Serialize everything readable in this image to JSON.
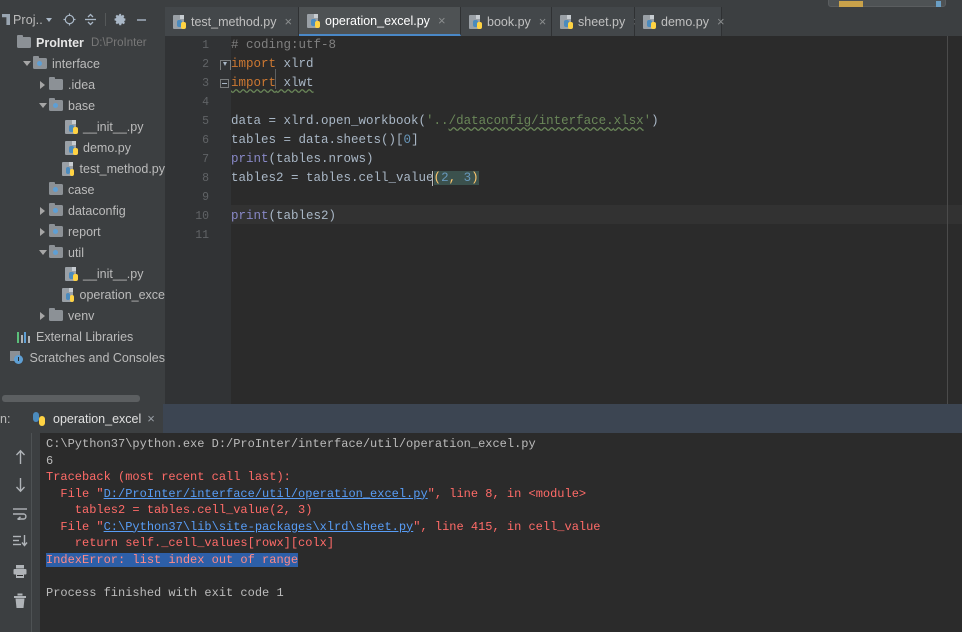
{
  "window": {
    "project_panel": {
      "title": "Proj..",
      "icons": [
        "locate-icon",
        "collapse-all-icon",
        "settings-gear-icon",
        "minimize-icon"
      ]
    },
    "root": {
      "name": "ProInter",
      "path": "D:\\ProInter"
    }
  },
  "tree": [
    {
      "label": "ProInter",
      "sub": "D:\\ProInter",
      "indent": 0,
      "type": "root-folder",
      "arrow": "none",
      "bold": true
    },
    {
      "label": "interface",
      "sub": "",
      "indent": 1,
      "type": "source-folder",
      "arrow": "down"
    },
    {
      "label": ".idea",
      "sub": "",
      "indent": 2,
      "type": "folder",
      "arrow": "right"
    },
    {
      "label": "base",
      "sub": "",
      "indent": 2,
      "type": "source-folder",
      "arrow": "down"
    },
    {
      "label": "__init__.py",
      "sub": "",
      "indent": 3,
      "type": "python-file",
      "arrow": "none"
    },
    {
      "label": "demo.py",
      "sub": "",
      "indent": 3,
      "type": "python-file",
      "arrow": "none"
    },
    {
      "label": "test_method.py",
      "sub": "",
      "indent": 3,
      "type": "python-file",
      "arrow": "none"
    },
    {
      "label": "case",
      "sub": "",
      "indent": 2,
      "type": "source-folder",
      "arrow": "none"
    },
    {
      "label": "dataconfig",
      "sub": "",
      "indent": 2,
      "type": "source-folder",
      "arrow": "right"
    },
    {
      "label": "report",
      "sub": "",
      "indent": 2,
      "type": "source-folder",
      "arrow": "right"
    },
    {
      "label": "util",
      "sub": "",
      "indent": 2,
      "type": "source-folder",
      "arrow": "down"
    },
    {
      "label": "__init__.py",
      "sub": "",
      "indent": 3,
      "type": "python-file",
      "arrow": "none"
    },
    {
      "label": "operation_exce",
      "sub": "",
      "indent": 3,
      "type": "python-file",
      "arrow": "none"
    },
    {
      "label": "venv",
      "sub": "",
      "indent": 2,
      "type": "folder",
      "arrow": "right"
    },
    {
      "label": "External Libraries",
      "sub": "",
      "indent": 0,
      "type": "external-libraries",
      "arrow": "none"
    },
    {
      "label": "Scratches and Consoles",
      "sub": "",
      "indent": 0,
      "type": "scratches",
      "arrow": "none"
    }
  ],
  "tabs": [
    {
      "label": "test_method.py",
      "active": false
    },
    {
      "label": "operation_excel.py",
      "active": true
    },
    {
      "label": "book.py",
      "active": false
    },
    {
      "label": "sheet.py",
      "active": false
    },
    {
      "label": "demo.py",
      "active": false
    }
  ],
  "editor": {
    "line_numbers": [
      "1",
      "2",
      "3",
      "4",
      "5",
      "6",
      "7",
      "8",
      "9",
      "10",
      "11"
    ],
    "current_line": 8,
    "lines": [
      "# coding:utf-8",
      "import xlrd",
      "import xlwt",
      "",
      "data = xlrd.open_workbook('../dataconfig/interface.xlsx')",
      "tables = data.sheets()[0]",
      "print(tables.nrows)",
      "tables2 = tables.cell_value(2, 3)",
      "",
      "print(tables2)",
      ""
    ]
  },
  "run_panel": {
    "label": "n:",
    "tab_label": "operation_excel",
    "close_label": "×",
    "toolbar_icons": [
      "rerun-up-icon",
      "down-arrow-icon",
      "soft-wrap-icon",
      "scroll-to-end-icon",
      "print-icon",
      "trash-icon"
    ],
    "console": {
      "command": "C:\\Python37\\python.exe D:/ProInter/interface/util/operation_excel.py",
      "output": "6",
      "traceback_header": "Traceback (most recent call last):",
      "frames": [
        {
          "prefix": "  File \"",
          "link": "D:/ProInter/interface/util/operation_excel.py",
          "suffix": "\", line 8, in <module>",
          "code": "    tables2 = tables.cell_value(2, 3)"
        },
        {
          "prefix": "  File \"",
          "link": "C:\\Python37\\lib\\site-packages\\xlrd\\sheet.py",
          "suffix": "\", line 415, in cell_value",
          "code": "    return self._cell_values[rowx][colx]"
        }
      ],
      "error": "IndexError: list index out of range",
      "exit_message": "Process finished with exit code 1"
    }
  },
  "colors": {
    "accent": "#4a88c7",
    "editor_bg": "#2b2b2b",
    "panel_bg": "#3c3f41",
    "error_red": "#ff6b68",
    "link_blue": "#589df6",
    "selection_blue": "#2d5fa8",
    "keyword_orange": "#cc7832",
    "string_green": "#6a8759",
    "number_blue": "#6897bb"
  }
}
